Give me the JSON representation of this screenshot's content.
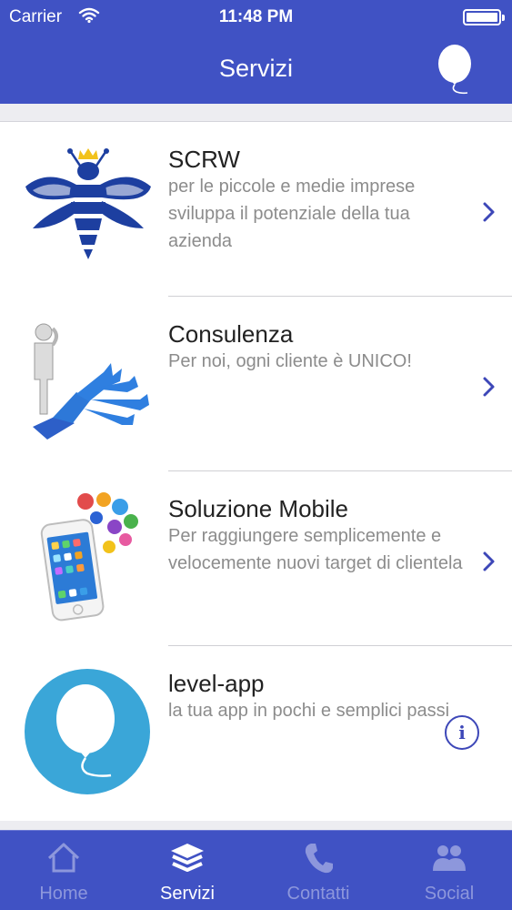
{
  "status_bar": {
    "carrier": "Carrier",
    "time": "11:48 PM"
  },
  "nav": {
    "title": "Servizi",
    "right_icon": "balloon-icon"
  },
  "services": [
    {
      "title": "SCRW",
      "description": "per le piccole e medie imprese sviluppa il potenziale della tua azienda",
      "icon": "bee-logo",
      "accessory": "chevron-right-icon"
    },
    {
      "title": "Consulenza",
      "description": "Per noi, ogni cliente è UNICO!",
      "icon": "consulting-arrows-figure",
      "accessory": "chevron-right-icon"
    },
    {
      "title": "Soluzione Mobile",
      "description": "Per raggiungere semplicemente e velocemente nuovi target di clientela",
      "icon": "smartphone-apps",
      "accessory": "chevron-right-icon"
    },
    {
      "title": "level-app",
      "description": "la tua app in pochi e semplici passi",
      "icon": "balloon-logo",
      "accessory": "info-icon",
      "accessory_text": "i"
    }
  ],
  "tabs": [
    {
      "label": "Home",
      "icon": "home-icon",
      "active": false
    },
    {
      "label": "Servizi",
      "icon": "layers-icon",
      "active": true
    },
    {
      "label": "Contatti",
      "icon": "phone-icon",
      "active": false
    },
    {
      "label": "Social",
      "icon": "people-icon",
      "active": false
    }
  ],
  "colors": {
    "bar": "#4052c4",
    "accent": "#3d47b8",
    "tab_inactive": "#8d97dc",
    "balloon_blue": "#3aa6d8"
  }
}
